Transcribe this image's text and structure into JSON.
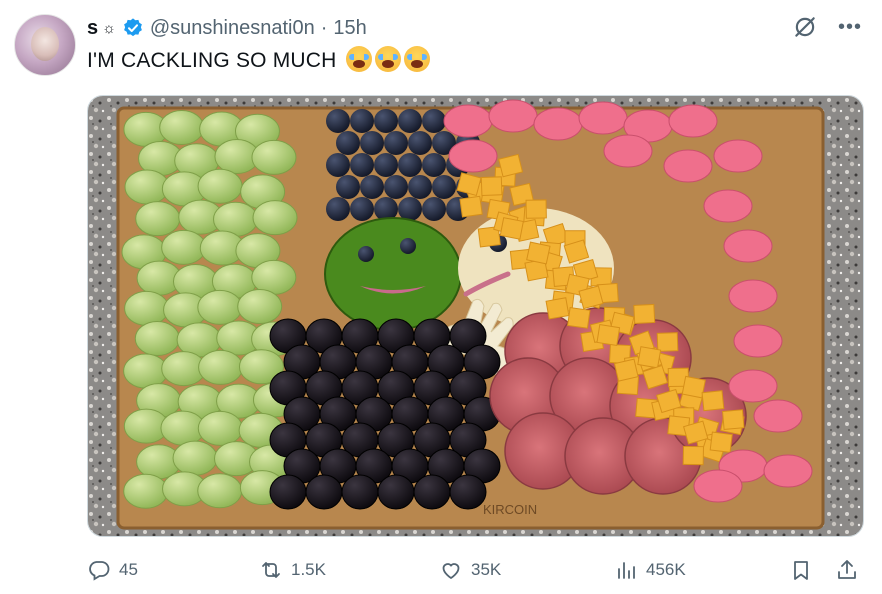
{
  "author": {
    "display_name": "s",
    "name_emoji": "☼",
    "handle": "@sunshinesnati0n",
    "separator": "·",
    "time": "15h",
    "verified": true
  },
  "tweet": {
    "text": "I'M CACKLING SO MUCH",
    "emojis": [
      "loudly-crying-face",
      "loudly-crying-face",
      "loudly-crying-face"
    ]
  },
  "media": {
    "description_icon": "photo",
    "board_brand_text": "KIRCOIN"
  },
  "actions": {
    "replies": "45",
    "reposts": "1.5K",
    "likes": "35K",
    "views": "456K"
  },
  "colors": {
    "verified_blue": "#1d9bf0",
    "muted_gray": "#536471",
    "text": "#0f1419"
  }
}
